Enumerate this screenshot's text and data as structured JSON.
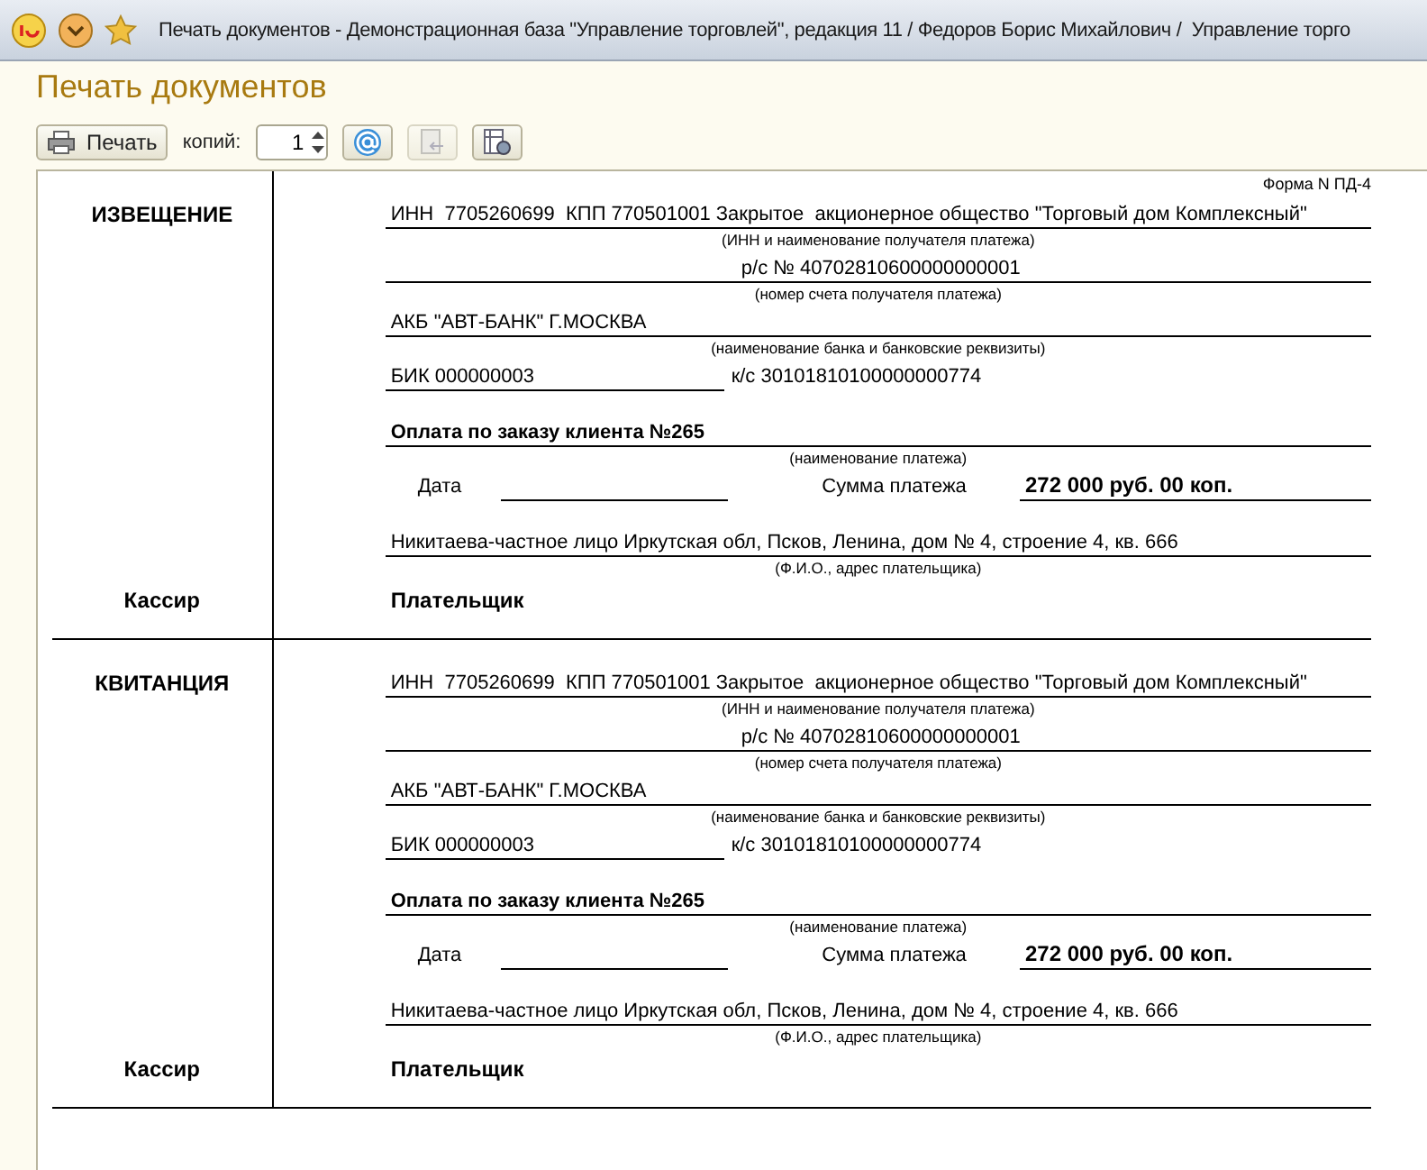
{
  "window": {
    "title": "Печать документов - Демонстрационная база \"Управление торговлей\", редакция 11 / Федоров Борис Михайлович /  Управление торго"
  },
  "page_title": "Печать документов",
  "toolbar": {
    "print_button": "Печать",
    "copies_label": "копий:",
    "copies_value": "1",
    "send_disabled": true
  },
  "form_label": "Форма N ПД-4",
  "sections": [
    {
      "title": "ИЗВЕЩЕНИЕ",
      "recipient": "ИНН  7705260699  КПП 770501001 Закрытое  акционерное общество \"Торговый дом Комплексный\"",
      "recipient_caption": "(ИНН и наименование получателя платежа)",
      "account": "р/с № 40702810600000000001",
      "account_caption": "(номер счета получателя платежа)",
      "bank": "АКБ \"АВТ-БАНК\" Г.МОСКВА",
      "bank_caption": "(наименование банка и банковские реквизиты)",
      "bik": "БИК 000000003",
      "ks": "к/с 30101810100000000774",
      "payment": "Оплата по заказу клиента №265",
      "payment_caption": "(наименование платежа)",
      "date_label": "Дата",
      "sum_label": "Сумма платежа",
      "sum": "272 000 руб. 00 коп.",
      "payer": "Никитаева-частное лицо Иркутская обл, Псков, Ленина, дом № 4, строение 4, кв. 666",
      "payer_caption": "(Ф.И.О., адрес плательщика)",
      "cashier": "Кассир",
      "payer_label": "Плательщик"
    },
    {
      "title": "КВИТАНЦИЯ",
      "recipient": "ИНН  7705260699  КПП 770501001 Закрытое  акционерное общество \"Торговый дом Комплексный\"",
      "recipient_caption": "(ИНН и наименование получателя платежа)",
      "account": "р/с № 40702810600000000001",
      "account_caption": "(номер счета получателя платежа)",
      "bank": "АКБ \"АВТ-БАНК\" Г.МОСКВА",
      "bank_caption": "(наименование банка и банковские реквизиты)",
      "bik": "БИК 000000003",
      "ks": "к/с 30101810100000000774",
      "payment": "Оплата по заказу клиента №265",
      "payment_caption": "(наименование платежа)",
      "date_label": "Дата",
      "sum_label": "Сумма платежа",
      "sum": "272 000 руб. 00 коп.",
      "payer": "Никитаева-частное лицо Иркутская обл, Псков, Ленина, дом № 4, строение 4, кв. 666",
      "payer_caption": "(Ф.И.О., адрес плательщика)",
      "cashier": "Кассир",
      "payer_label": "Плательщик"
    }
  ]
}
